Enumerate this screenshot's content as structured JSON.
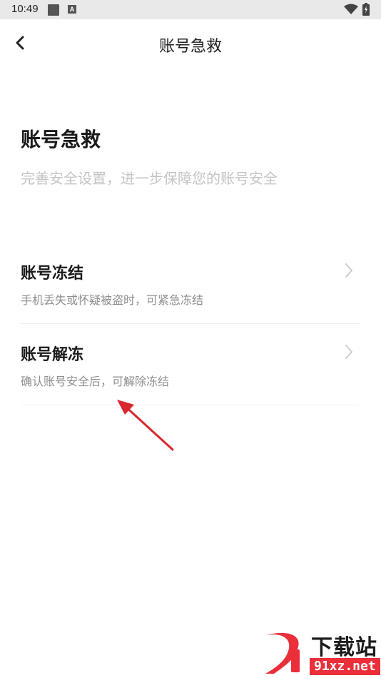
{
  "status_bar": {
    "time": "10:49",
    "notif_letter": "A"
  },
  "header": {
    "title": "账号急救"
  },
  "hero": {
    "title": "账号急救",
    "subtitle": "完善安全设置，进一步保障您的账号安全"
  },
  "items": [
    {
      "title": "账号冻结",
      "desc": "手机丢失或怀疑被盗时，可紧急冻结"
    },
    {
      "title": "账号解冻",
      "desc": "确认账号安全后，可解除冻结"
    }
  ],
  "watermark": {
    "cn": "下载站",
    "url": "91xz.net"
  },
  "colors": {
    "accent_red": "#ea2f3a",
    "subtitle_gray": "#c4c4c4",
    "desc_gray": "#8e8e8e"
  },
  "icons": [
    "back-arrow-icon",
    "chevron-right-icon",
    "wifi-icon",
    "battery-icon"
  ]
}
